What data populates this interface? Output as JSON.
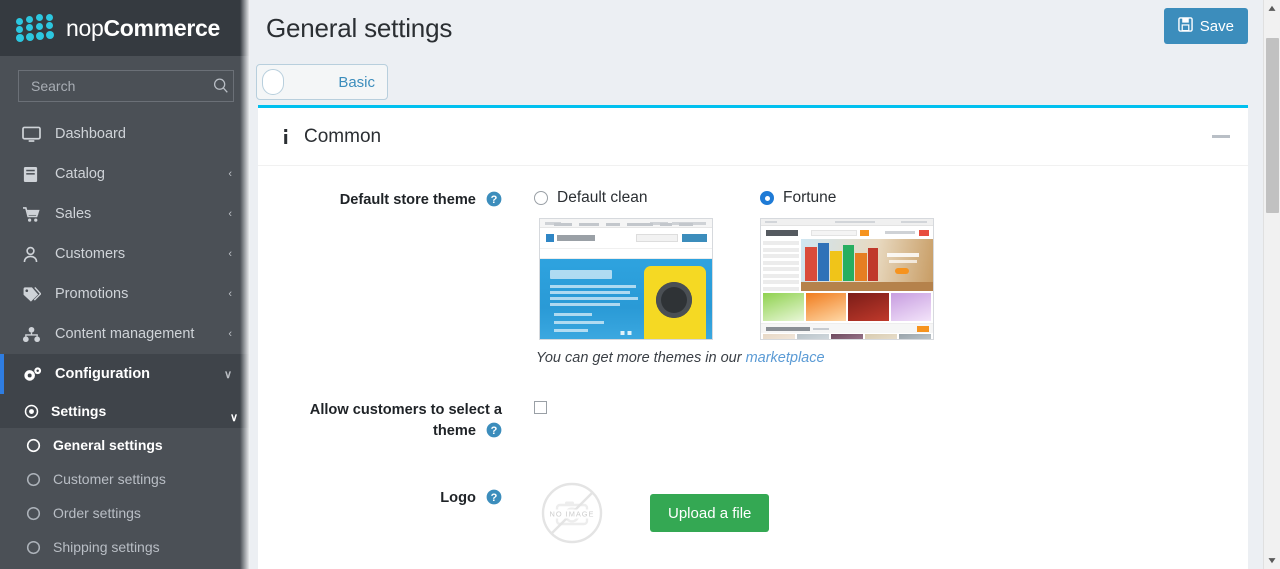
{
  "brand": {
    "name_light": "nop",
    "name_bold": "Commerce",
    "logo_color": "#2cc7e0"
  },
  "search": {
    "placeholder": "Search",
    "value": "",
    "icon": "search-icon"
  },
  "sidebar": {
    "items": [
      {
        "label": "Dashboard",
        "icon": "monitor-icon",
        "arrow": "",
        "active": false
      },
      {
        "label": "Catalog",
        "icon": "book-icon",
        "arrow": "‹",
        "active": false
      },
      {
        "label": "Sales",
        "icon": "cart-icon",
        "arrow": "‹",
        "active": false
      },
      {
        "label": "Customers",
        "icon": "user-icon",
        "arrow": "‹",
        "active": false
      },
      {
        "label": "Promotions",
        "icon": "tag-icon",
        "arrow": "‹",
        "active": false
      },
      {
        "label": "Content management",
        "icon": "sitemap-icon",
        "arrow": "‹",
        "active": false
      },
      {
        "label": "Configuration",
        "icon": "gears-icon",
        "arrow": "∨",
        "active": true
      }
    ],
    "sub_items": [
      {
        "label": "Settings",
        "icon": "radio-filled-icon",
        "arrow": "∨",
        "level": 1,
        "current": false
      },
      {
        "label": "General settings",
        "icon": "radio-circle-icon",
        "arrow": "",
        "level": 2,
        "current": true
      },
      {
        "label": "Customer settings",
        "icon": "radio-circle-icon",
        "arrow": "",
        "level": 2,
        "current": false
      },
      {
        "label": "Order settings",
        "icon": "radio-circle-icon",
        "arrow": "",
        "level": 2,
        "current": false
      },
      {
        "label": "Shipping settings",
        "icon": "radio-circle-icon",
        "arrow": "",
        "level": 2,
        "current": false
      }
    ]
  },
  "header": {
    "title": "General settings",
    "save_label": "Save",
    "save_icon": "floppy-disk-icon",
    "save_color": "#3c8dbc"
  },
  "tabs": {
    "basic_label": "Basic",
    "toggle_state": "off"
  },
  "card": {
    "title": "Common",
    "info_icon": "info-icon",
    "collapse_icon": "minus-icon",
    "accent_color": "#00c0ef"
  },
  "fields": {
    "theme": {
      "label": "Default store theme",
      "help_icon": "question-circle-icon",
      "options": [
        {
          "name": "Default clean",
          "selected": false,
          "thumb_title": "Nokia Lumia 1020"
        },
        {
          "name": "Fortune",
          "selected": true,
          "thumb_title": "MEGASTORE"
        }
      ],
      "hint_text": "You can get more themes in our ",
      "hint_link": "marketplace"
    },
    "allow_select_theme": {
      "label": "Allow customers to select a theme",
      "help_icon": "question-circle-icon",
      "checked": false
    },
    "logo": {
      "label": "Logo",
      "help_icon": "question-circle-icon",
      "placeholder_text": "NO IMAGE",
      "upload_label": "Upload a file",
      "upload_color": "#34a853"
    }
  },
  "scrollbar": {
    "up_arrow": "▲",
    "down_arrow": "▼"
  }
}
